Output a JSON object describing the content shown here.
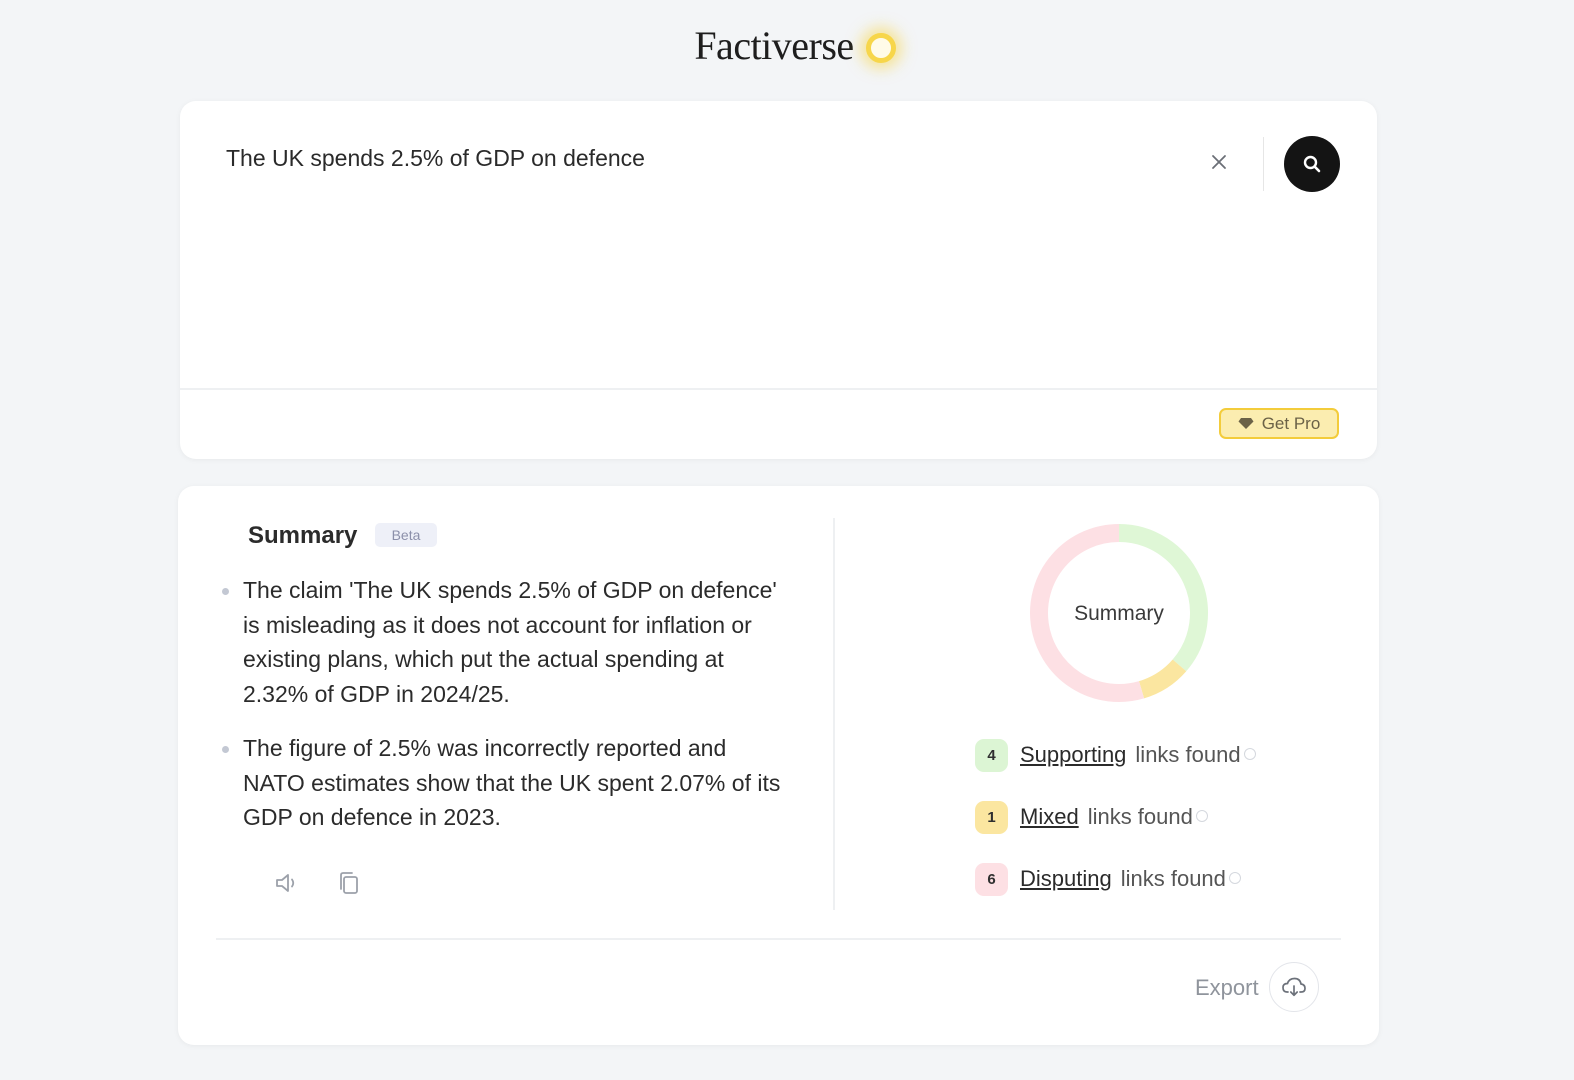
{
  "app": {
    "logo_text": "Factiverse"
  },
  "search": {
    "query": "The UK spends 2.5% of GDP on defence",
    "clear_icon": "close-icon",
    "search_icon": "search-icon",
    "get_pro_label": "Get Pro",
    "get_pro_icon": "diamond-icon"
  },
  "summary": {
    "title": "Summary",
    "badge": "Beta",
    "bullets": [
      "The claim 'The UK spends 2.5% of GDP on defence' is misleading as it does not account for inflation or existing plans, which put the actual spending at 2.32% of GDP in 2024/25.",
      "The figure of 2.5% was incorrectly reported and NATO estimates show that the UK spent 2.07% of its GDP on defence in 2023."
    ],
    "actions": {
      "speak_icon": "speaker-icon",
      "copy_icon": "copy-icon"
    },
    "donut": {
      "center_label": "Summary",
      "segments": [
        {
          "name": "Supporting",
          "count": 4,
          "color": "#dff7d6"
        },
        {
          "name": "Mixed",
          "count": 1,
          "color": "#fbe6a0"
        },
        {
          "name": "Disputing",
          "count": 6,
          "color": "#fde0e4"
        }
      ]
    },
    "legend": [
      {
        "count": "4",
        "label": "Supporting",
        "suffix": "links found",
        "color": "#dcf5d4"
      },
      {
        "count": "1",
        "label": "Mixed",
        "suffix": "links found",
        "color": "#fbe6a0"
      },
      {
        "count": "6",
        "label": "Disputing",
        "suffix": "links found",
        "color": "#fde0e4"
      }
    ],
    "export_label": "Export",
    "export_icon": "cloud-download-icon"
  }
}
